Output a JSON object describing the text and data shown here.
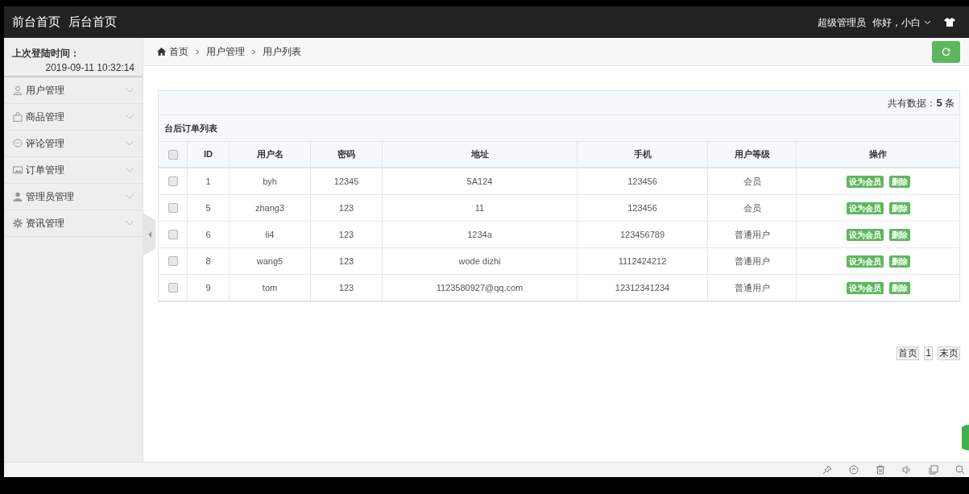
{
  "header": {
    "links": [
      "前台首页",
      "后台首页"
    ],
    "role": "超级管理员",
    "greeting": "你好，小白"
  },
  "sidebar": {
    "last_login_label": "上次登陆时间：",
    "last_login_time": "2019-09-11 10:32:14",
    "items": [
      {
        "label": "用户管理",
        "kind": "user"
      },
      {
        "label": "商品管理",
        "kind": "bag"
      },
      {
        "label": "评论管理",
        "kind": "chat"
      },
      {
        "label": "订单管理",
        "kind": "image"
      },
      {
        "label": "管理员管理",
        "kind": "person"
      },
      {
        "label": "资讯管理",
        "kind": "gear"
      }
    ]
  },
  "breadcrumb": [
    "首页",
    "用户管理",
    "用户列表"
  ],
  "total": {
    "label": "共有数据：",
    "count": "5",
    "unit": "条"
  },
  "table": {
    "title": "台后订单列表",
    "header_checked": false,
    "columns": [
      "ID",
      "用户名",
      "密码",
      "地址",
      "手机",
      "用户等级",
      "操作"
    ],
    "rows": [
      {
        "checked": false,
        "cells": [
          "1",
          "byh",
          "12345",
          "5A124",
          "123456",
          "会员"
        ],
        "actions": [
          "设为会员",
          "删除"
        ]
      },
      {
        "checked": false,
        "cells": [
          "5",
          "zhang3",
          "123",
          "11",
          "123456",
          "会员"
        ],
        "actions": [
          "设为会员",
          "删除"
        ]
      },
      {
        "checked": false,
        "cells": [
          "6",
          "li4",
          "123",
          "1234a",
          "123456789",
          "普通用户"
        ],
        "actions": [
          "设为会员",
          "删除"
        ]
      },
      {
        "checked": false,
        "cells": [
          "8",
          "wang5",
          "123",
          "wode dizhi",
          "1112424212",
          "普通用户"
        ],
        "actions": [
          "设为会员",
          "删除"
        ]
      },
      {
        "checked": false,
        "cells": [
          "9",
          "tom",
          "123",
          "1123580927@qq.com",
          "12312341234",
          "普通用户"
        ],
        "actions": [
          "设为会员",
          "删除"
        ]
      }
    ]
  },
  "pagination": [
    "首页",
    "1",
    "末页"
  ]
}
